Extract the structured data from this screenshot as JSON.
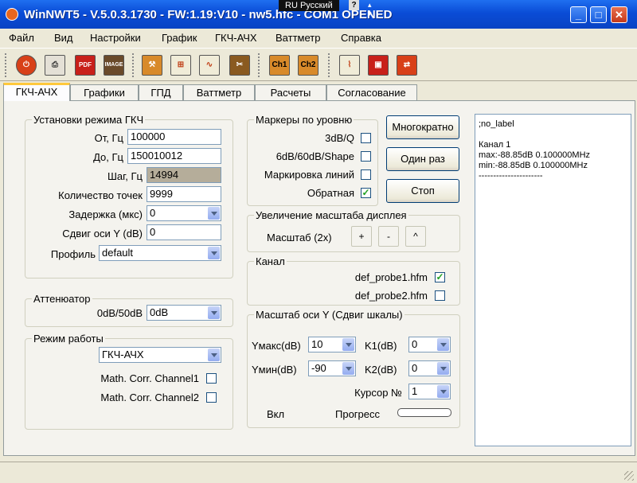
{
  "window": {
    "title": "WinNWT5 - V.5.0.3.1730 - FW:1.19:V10 - ",
    "title_tail": "nw5.hfc - COM1 OPENED",
    "language_indicator": "RU Русский",
    "help_glyph": "?",
    "minimize_glyph": "_",
    "maximize_glyph": "□",
    "close_glyph": "✕"
  },
  "menu": [
    "Файл",
    "Вид",
    "Настройки",
    "График",
    "ГКЧ-АЧХ",
    "Ваттметр",
    "Справка"
  ],
  "toolbar": {
    "icons": [
      "power-icon",
      "print-icon",
      "pdf-icon",
      "image-icon",
      "settings-icon",
      "graph-icon",
      "sweep-icon",
      "tools-icon",
      "channel1-icon",
      "channel2-icon",
      "chart-icon",
      "save-icon",
      "swap-icon"
    ],
    "pdf_label": "PDF",
    "image_label": "IMAGE",
    "ch1_label": "Ch1",
    "ch2_label": "Ch2"
  },
  "tabs": [
    "ГКЧ-АЧХ",
    "Графики",
    "ГПД",
    "Ваттметр",
    "Расчеты",
    "Согласование"
  ],
  "sweep_settings": {
    "title": "Установки режима ГКЧ",
    "from_label": "От, Гц",
    "from_value": "100000",
    "to_label": "До, Гц",
    "to_value": "150010012",
    "step_label": "Шаг, Гц",
    "step_value": "14994",
    "points_label": "Количество точек",
    "points_value": "9999",
    "delay_label": "Задержка (мкс)",
    "delay_value": "0",
    "yshift_label": "Сдвиг оси Y (dB)",
    "yshift_value": "0",
    "profile_label": "Профиль",
    "profile_value": "default"
  },
  "attenuator": {
    "title": "Аттенюатор",
    "label": "0dB/50dB",
    "value": "0dB"
  },
  "mode": {
    "title": "Режим работы",
    "value": "ГКЧ-АЧХ",
    "math1_label": "Math. Corr. Channel1",
    "math2_label": "Math. Corr. Channel2"
  },
  "markers": {
    "title": "Маркеры по уровню",
    "m1": "3dB/Q",
    "m2": "6dB/60dB/Shape",
    "m3": "Маркировка линий",
    "m4": "Обратная",
    "checked": [
      false,
      false,
      false,
      true
    ]
  },
  "actions": {
    "multi": "Многократно",
    "once": "Один раз",
    "stop": "Стоп"
  },
  "zoom": {
    "title": "Увеличение масштаба дисплея",
    "label": "Масштаб (2x)",
    "plus": "+",
    "minus": "-",
    "caret": "^"
  },
  "channel": {
    "title": "Канал",
    "probe1": "def_probe1.hfm",
    "probe2": "def_probe2.hfm",
    "checked": [
      true,
      false
    ]
  },
  "yscale": {
    "title": "Масштаб оси Y (Сдвиг шкалы)",
    "ymax_label": "Yмакс(dB)",
    "ymax_value": "10",
    "ymin_label": "Yмин(dB)",
    "ymin_value": "-90",
    "k1_label": "K1(dB)",
    "k1_value": "0",
    "k2_label": "K2(dB)",
    "k2_value": "0",
    "cursor_label": "Курсор №",
    "cursor_value": "1",
    "on_label": "Вкл",
    "progress_label": "Прогресс",
    "progress": 0
  },
  "log": {
    "lines": ";no_label\n\nКанал 1\nmax:-88.85dB 0.100000MHz\nmin:-88.85dB 0.100000MHz\n----------------------"
  },
  "colors": {
    "titlebar": "#0a4cd6",
    "window_bg": "#ECE9D8",
    "active_tab_accent": "#ffc83c"
  }
}
